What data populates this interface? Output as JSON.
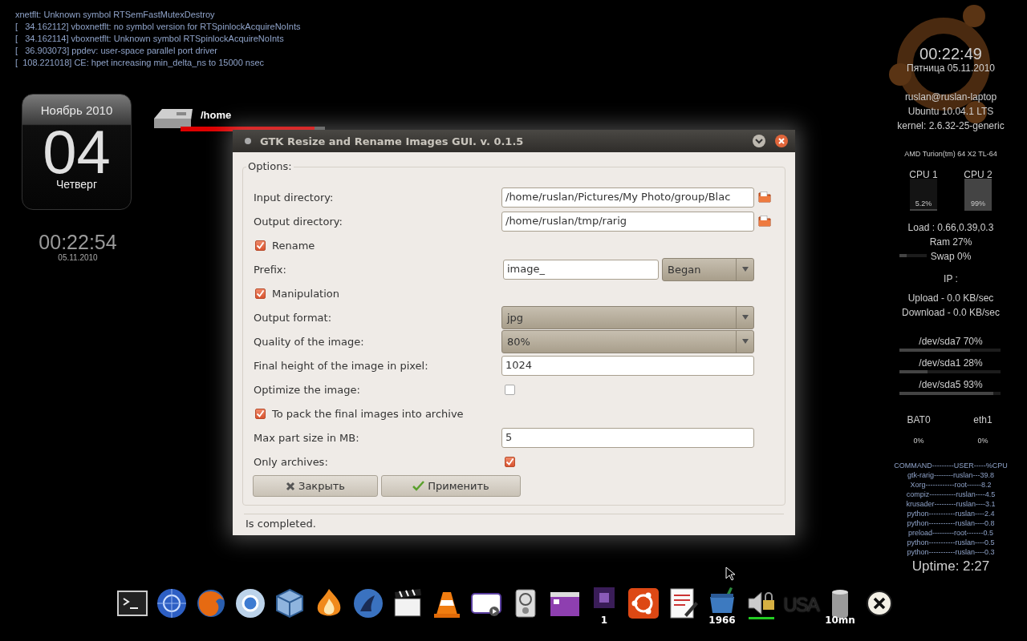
{
  "log_lines": [
    "xnetflt: Unknown symbol RTSemFastMutexDestroy",
    "[   34.162112] vboxnetflt: no symbol version for RTSpinlockAcquireNoInts",
    "[   34.162114] vboxnetflt: Unknown symbol RTSpinlockAcquireNoInts",
    "[   36.903073] ppdev: user-space parallel port driver",
    "[  108.221018] CE: hpet increasing min_delta_ns to 15000 nsec"
  ],
  "calendar": {
    "month": "Ноябрь 2010",
    "day": "04",
    "weekday": "Четверг"
  },
  "left_clock": {
    "time": "00:22:54",
    "date": "05.11.2010"
  },
  "disk": {
    "name": "/home",
    "level": 0.93
  },
  "dialog": {
    "title": "GTK Resize and Rename Images GUI. v. 0.1.5",
    "options_label": "Options:",
    "rows": [
      {
        "kind": "path",
        "label": "Input directory:",
        "value": "/home/ruslan/Pictures/My Photo/group/Blac"
      },
      {
        "kind": "path",
        "label": "Output directory:",
        "value": "/home/ruslan/tmp/rarig"
      },
      {
        "kind": "check",
        "label": "Rename",
        "checked": true
      },
      {
        "kind": "entry_combo",
        "label": "Prefix:",
        "value": "image_",
        "option": "Began"
      },
      {
        "kind": "check",
        "label": "Manipulation",
        "checked": true
      },
      {
        "kind": "combo",
        "label": "Output format:",
        "option": "jpg"
      },
      {
        "kind": "combo",
        "label": "Quality of the image:",
        "option": "80%"
      },
      {
        "kind": "entry",
        "label": "Final height of the image in pixel:",
        "value": "1024"
      },
      {
        "kind": "toggle",
        "label": "Optimize the image:",
        "checked": false
      },
      {
        "kind": "check",
        "label": "To pack the final images into archive",
        "checked": true
      },
      {
        "kind": "entry",
        "label": "Max part size in MB:",
        "value": "5"
      },
      {
        "kind": "toggle",
        "label": "Only archives:",
        "checked": true
      }
    ],
    "buttons": [
      {
        "kind": "close",
        "label": "Закрыть"
      },
      {
        "kind": "apply",
        "label": "Применить"
      }
    ],
    "status": "Is completed."
  },
  "conky": {
    "time": "00:22:49",
    "date": "Пятница 05.11.2010",
    "user": "ruslan@ruslan-laptop",
    "os": "Ubuntu 10.04.1 LTS",
    "kernel": "kernel: 2.6.32-25-generic",
    "cpu_model": "AMD Turion(tm) 64 X2 TL-64",
    "cpus": [
      {
        "label": "CPU 1",
        "reading": "5.2%",
        "level": 0.052
      },
      {
        "label": "CPU 2",
        "reading": "99%",
        "level": 0.99
      }
    ],
    "load": "Load : 0.66,0.39,0.3",
    "ram": {
      "label": "Ram 27%",
      "level": 0.27
    },
    "swap": "Swap 0%",
    "ip": "IP :",
    "upload": "Upload - 0.0 KB/sec",
    "download": "Download - 0.0 KB/sec",
    "disks": [
      {
        "label": "/dev/sda7 70%",
        "level": 0.7
      },
      {
        "label": "/dev/sda1 28%",
        "level": 0.28
      },
      {
        "label": "/dev/sda5 93%",
        "level": 0.93
      }
    ],
    "meters": [
      {
        "label": "BAT0",
        "reading": "0%"
      },
      {
        "label": "eth1",
        "reading": "0%"
      }
    ],
    "top_header": "COMMAND---------USER-----%CPU",
    "processes": [
      "gtk-rarig--------ruslan---39.8",
      "Xorg------------root------8.2",
      "compiz-----------ruslan----4.5",
      "krusader---------ruslan----3.1",
      "python-----------ruslan----2.4",
      "python-----------ruslan----0.8",
      "preload---------root-------0.5",
      "python-----------ruslan----0.5",
      "python-----------ruslan----0.3"
    ],
    "uptime": "Uptime: 2:27"
  },
  "dock": {
    "workspace_label": "1",
    "trash_count": "1966",
    "layout_label": "USA",
    "timer_label": "10mn"
  }
}
